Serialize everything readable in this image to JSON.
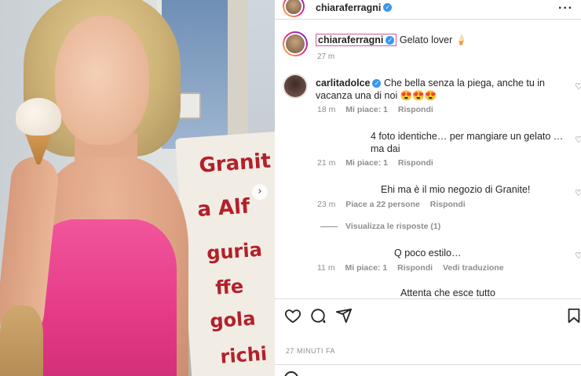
{
  "post": {
    "username": "chiaraferragni",
    "caption_user": "chiaraferragni",
    "caption_text": "Gelato lover 🍦",
    "caption_time": "27 m",
    "timestamp": "27 MINUTI FA"
  },
  "photo": {
    "sign_words": [
      "Granit",
      "a Alf",
      "guria",
      "ffe",
      "gola",
      "richi"
    ]
  },
  "comments": [
    {
      "user": "carlitadolce",
      "text": "Che bella senza la piega, anche tu in vacanza una di noi 😍😍😍",
      "time": "18 m",
      "likes": "Mi piace: 1",
      "reply": "Rispondi"
    },
    {
      "user": "",
      "text": "4 foto identiche… per mangiare un gelato … ma dai",
      "time": "21 m",
      "likes": "Mi piace: 1",
      "reply": "Rispondi"
    },
    {
      "user": "",
      "text": "Ehi ma è il mio negozio di Granite!",
      "time": "23 m",
      "likes": "Piace a 22 persone",
      "reply": "Rispondi"
    },
    {
      "user": "",
      "text": "Q poco estilo…",
      "time": "11 m",
      "likes": "Mi piace: 1",
      "reply": "Rispondi",
      "translate": "Vedi traduzione"
    },
    {
      "user": "",
      "text": "Attenta che esce tutto"
    }
  ],
  "view_replies": "Visualizza le risposte (1)",
  "icons": {
    "more": "more-icon",
    "verified": "verified-badge-icon",
    "heart": "heart-icon",
    "comment": "comment-icon",
    "share": "share-icon",
    "save": "bookmark-icon",
    "next": "chevron-right-icon"
  },
  "colors": {
    "verified": "#3897f0",
    "secondary_text": "#8e8e8e",
    "dress_pink": "#e43a86"
  }
}
